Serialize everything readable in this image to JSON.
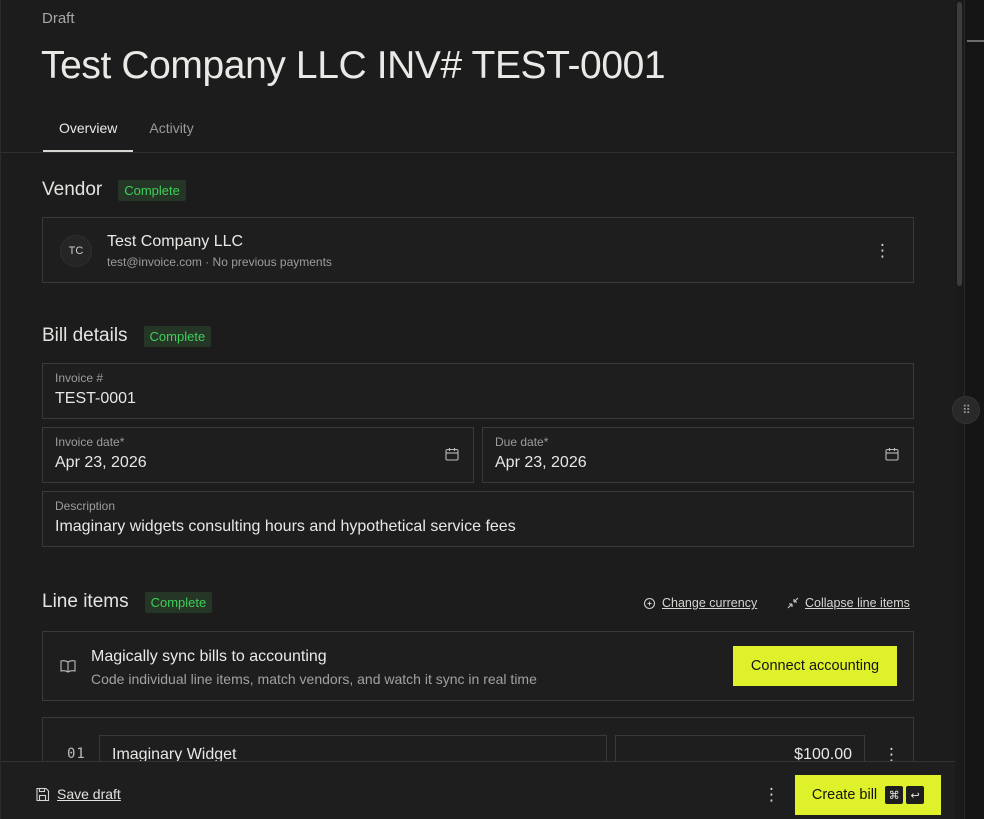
{
  "header": {
    "status": "Draft",
    "title": "Test Company LLC INV# TEST-0001"
  },
  "tabs": [
    {
      "label": "Overview",
      "active": true
    },
    {
      "label": "Activity",
      "active": false
    }
  ],
  "vendor": {
    "section_title": "Vendor",
    "badge": "Complete",
    "initials": "TC",
    "name": "Test Company LLC",
    "meta": "test@invoice.com · No previous payments",
    "more_icon": "vertical-dots-icon"
  },
  "bill_details": {
    "section_title": "Bill details",
    "badge": "Complete",
    "invoice_number": {
      "label": "Invoice #",
      "value": "TEST-0001"
    },
    "invoice_date": {
      "label": "Invoice date*",
      "value": "Apr 23, 2026"
    },
    "due_date": {
      "label": "Due date*",
      "value": "Apr 23, 2026"
    },
    "description": {
      "label": "Description",
      "value": "Imaginary widgets consulting hours and hypothetical service fees"
    }
  },
  "line_items": {
    "section_title": "Line items",
    "badge": "Complete",
    "change_currency": "Change currency",
    "collapse": "Collapse line items",
    "sync": {
      "title": "Magically sync bills to accounting",
      "subtitle": "Code individual line items, match vendors, and watch it sync in real time",
      "button": "Connect accounting"
    },
    "items": [
      {
        "number": "01",
        "name": "Imaginary Widget",
        "amount": "$100.00"
      }
    ]
  },
  "footer": {
    "save_draft": "Save draft",
    "create_bill": "Create bill",
    "shortcut_cmd": "⌘",
    "shortcut_enter": "↩"
  },
  "colors": {
    "background": "#1d1c1d",
    "accent": "#dff12a",
    "badge_text": "#3fcf5a",
    "badge_bg": "#253526"
  }
}
